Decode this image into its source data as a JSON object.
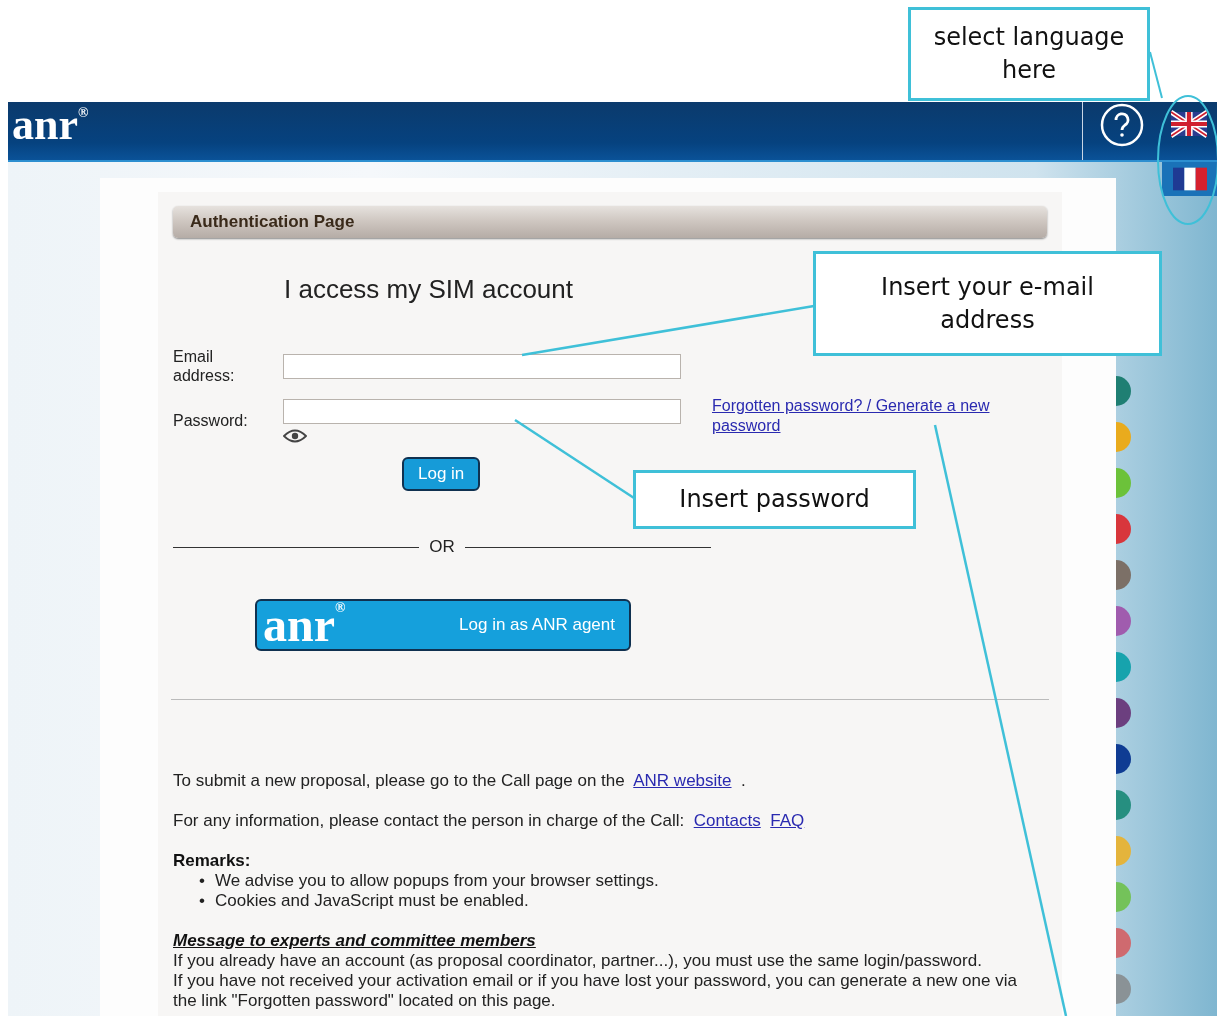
{
  "header": {
    "logo": "anr",
    "logo_mark": "®"
  },
  "auth_bar": {
    "title": "Authentication Page"
  },
  "heading": "I access my SIM account",
  "form": {
    "fields": [
      {
        "label": "Email address:",
        "kind": "text"
      },
      {
        "label": "Password:",
        "kind": "password"
      }
    ],
    "login_button": "Log in",
    "forgot_link": "Forgotten password? / Generate a new password"
  },
  "separator": "OR",
  "agent_button": {
    "logo": "anr",
    "logo_mark": "®",
    "label": "Log in as ANR agent"
  },
  "info": [
    {
      "text": "To submit a new proposal, please go to the Call page on the",
      "links": [
        "ANR website"
      ],
      "tail": "."
    },
    {
      "text": "For any information, please contact the person in charge of the Call:",
      "links": [
        "Contacts",
        "FAQ"
      ]
    }
  ],
  "remarks": {
    "title": "Remarks:",
    "bullet": "•",
    "items": [
      "We advise you to allow popups from your browser settings.",
      "Cookies and JavaScript must be enabled."
    ]
  },
  "message": {
    "title": "Message to experts and committee members",
    "lines": [
      "If you already have an account (as proposal coordinator, partner...), you must use the same login/password.",
      "If you have not received your activation email or if you have lost your password, you can generate a new one via the link \"Forgotten password\" located on this page."
    ]
  },
  "annotations": [
    {
      "text": "select language here"
    },
    {
      "text": "Insert your e-mail address"
    },
    {
      "text": "Insert password"
    }
  ]
}
